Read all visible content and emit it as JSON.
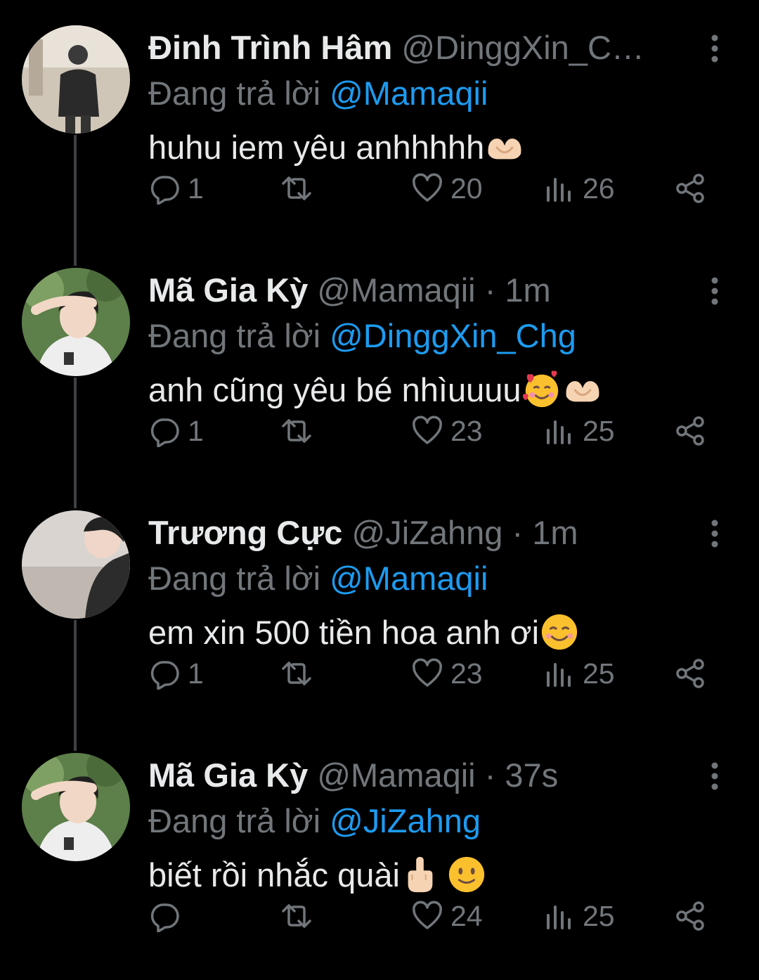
{
  "tweets": [
    {
      "name": "Đinh Trình Hâm",
      "handle": "@DinggXin_C…",
      "time": "",
      "reply_prefix": "Đang trả lời",
      "reply_to": "@Mamaqii",
      "text": "huhu iem yêu anhhhhh",
      "emojis": [
        "heart-hands-emoji"
      ],
      "replies": "1",
      "retweets": "",
      "likes": "20",
      "views": "26"
    },
    {
      "name": "Mã Gia Kỳ",
      "handle": "@Mamaqii",
      "time": "· 1m",
      "reply_prefix": "Đang trả lời",
      "reply_to": "@DinggXin_Chg",
      "text": "anh cũng yêu bé nhìuuuu",
      "emojis": [
        "smiling-face-with-hearts-emoji",
        "heart-hands-emoji"
      ],
      "replies": "1",
      "retweets": "",
      "likes": "23",
      "views": "25"
    },
    {
      "name": "Trương Cực",
      "handle": "@JiZahng",
      "time": "· 1m",
      "reply_prefix": "Đang trả lời",
      "reply_to": "@Mamaqii",
      "text": "em xin 500 tiền hoa anh ơi",
      "emojis": [
        "smiling-face-emoji"
      ],
      "replies": "1",
      "retweets": "",
      "likes": "23",
      "views": "25"
    },
    {
      "name": "Mã Gia Kỳ",
      "handle": "@Mamaqii",
      "time": "· 37s",
      "reply_prefix": "Đang trả lời",
      "reply_to": "@JiZahng",
      "text": "biết rồi nhắc quài",
      "emojis": [
        "middle-finger-emoji",
        "slightly-smiling-face-emoji"
      ],
      "replies": "",
      "retweets": "",
      "likes": "24",
      "views": "25"
    }
  ],
  "colors": {
    "background": "#000000",
    "text_primary": "#e7e9ea",
    "text_secondary": "#71767b",
    "mention": "#1d9bf0",
    "thread_line": "#3e4144"
  },
  "icons": {
    "reply": "reply-icon",
    "retweet": "retweet-icon",
    "like": "heart-icon",
    "views": "views-chart-icon",
    "share": "share-icon",
    "more": "more-options-icon"
  }
}
